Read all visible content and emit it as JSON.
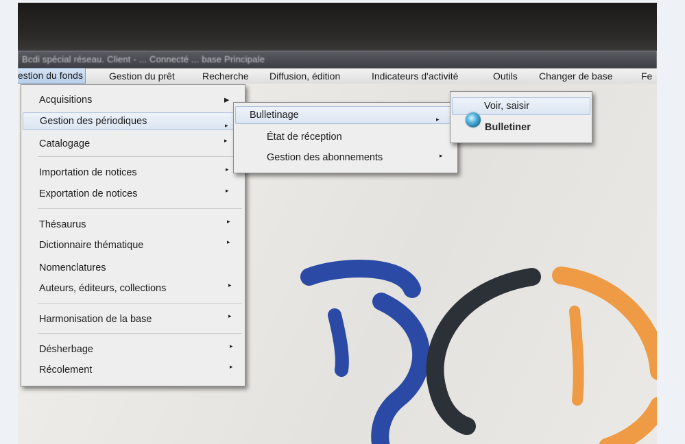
{
  "window": {
    "title": "Bcdi spécial réseau. Client - ... Connecté ... base Principale"
  },
  "menubar": {
    "items": [
      {
        "label": "estion du fonds"
      },
      {
        "label": "Gestion du prêt"
      },
      {
        "label": "Recherche"
      },
      {
        "label": "Diffusion, édition"
      },
      {
        "label": "Indicateurs d'activité"
      },
      {
        "label": "Outils"
      },
      {
        "label": "Changer de base"
      },
      {
        "label": "Fe"
      }
    ]
  },
  "menu_fonds": {
    "items": [
      {
        "label": "Acquisitions"
      },
      {
        "label": "Gestion des périodiques"
      },
      {
        "label": "Catalogage"
      },
      {
        "label": "Importation de notices"
      },
      {
        "label": "Exportation de notices"
      },
      {
        "label": "Thésaurus"
      },
      {
        "label": "Dictionnaire thématique"
      },
      {
        "label": "Nomenclatures"
      },
      {
        "label": "Auteurs, éditeurs, collections"
      },
      {
        "label": "Harmonisation de la base"
      },
      {
        "label": "Désherbage"
      },
      {
        "label": "Récolement"
      }
    ]
  },
  "menu_periodiques": {
    "items": [
      {
        "label": "Bulletinage"
      },
      {
        "label": "État de réception"
      },
      {
        "label": "Gestion des abonnements"
      }
    ]
  },
  "menu_bulletinage": {
    "items": [
      {
        "label": "Voir, saisir"
      },
      {
        "label": "Bulletiner"
      }
    ]
  },
  "logo": {
    "text": "BCD",
    "colors": {
      "b": "#2a4aa5",
      "c": "#2c3138",
      "d": "#ef9a44"
    }
  }
}
